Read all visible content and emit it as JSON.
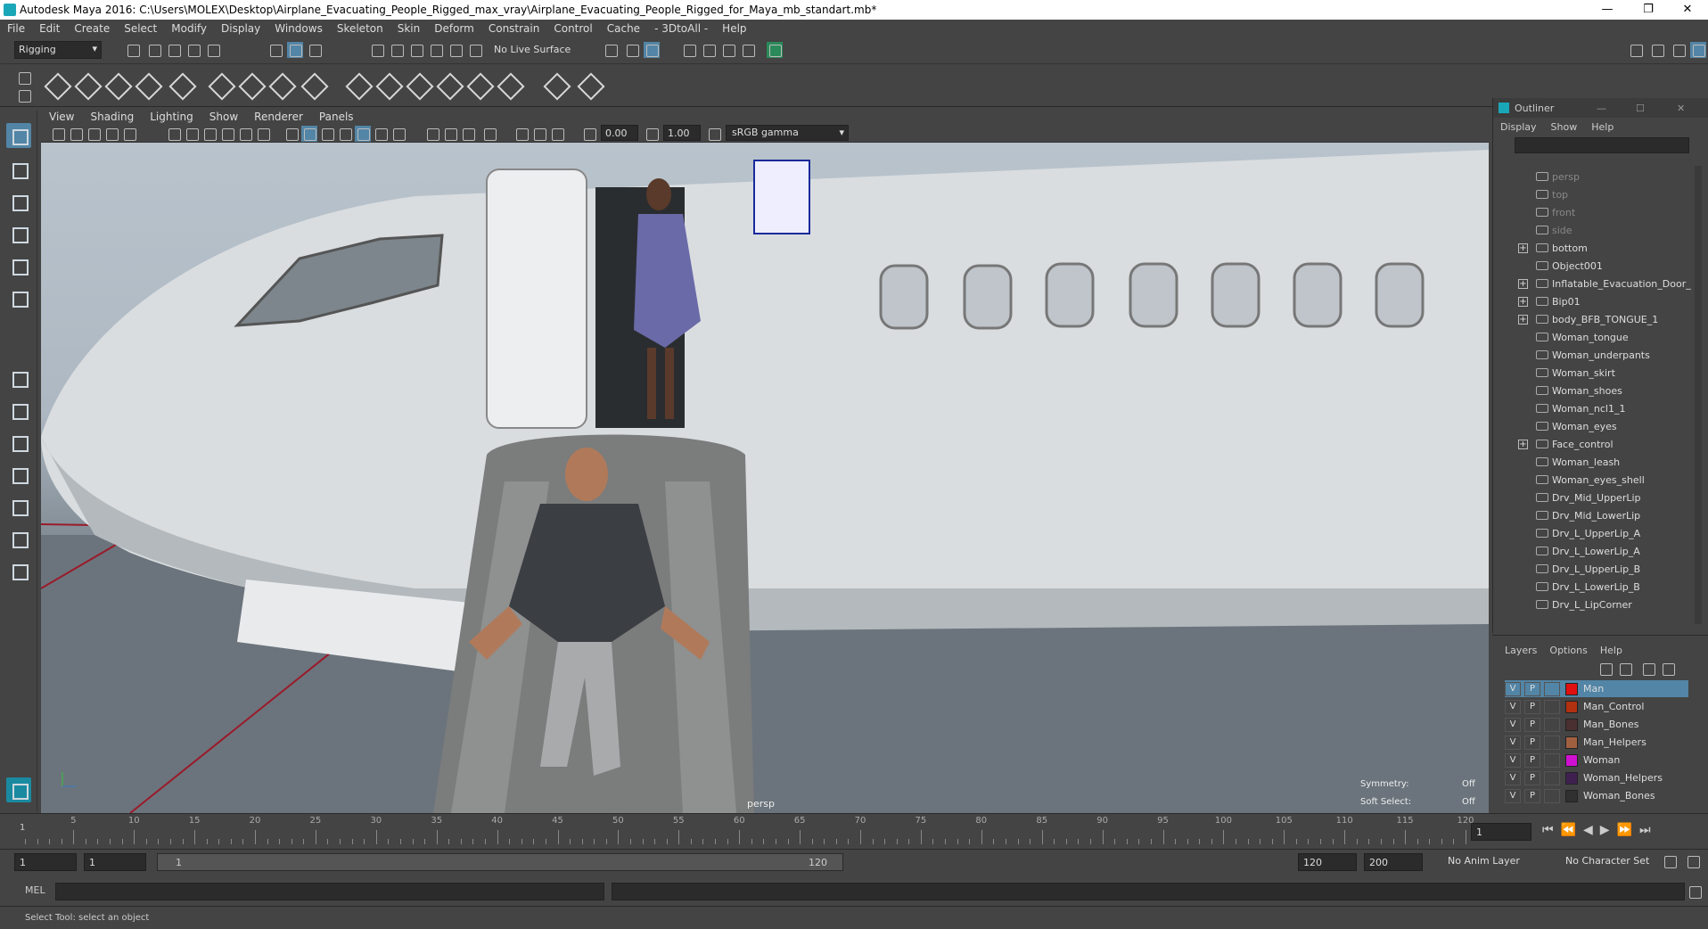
{
  "window": {
    "title": "Autodesk Maya 2016: C:\\Users\\MOLEX\\Desktop\\Airplane_Evacuating_People_Rigged_max_vray\\Airplane_Evacuating_People_Rigged_for_Maya_mb_standart.mb*",
    "controls": {
      "minimize": "—",
      "restore": "❐",
      "close": "✕"
    }
  },
  "menubar": [
    "File",
    "Edit",
    "Create",
    "Select",
    "Modify",
    "Display",
    "Windows",
    "Skeleton",
    "Skin",
    "Deform",
    "Constrain",
    "Control",
    "Cache",
    "- 3DtoAll -",
    "Help"
  ],
  "status_line": {
    "mode": "Rigging",
    "live_surface": "No Live Surface"
  },
  "viewport": {
    "menu": [
      "View",
      "Shading",
      "Lighting",
      "Show",
      "Renderer",
      "Panels"
    ],
    "exposure": "0.00",
    "gamma": "1.00",
    "color_space": "sRGB gamma",
    "camera_label": "persp",
    "symmetry_label": "Symmetry:",
    "symmetry_value": "Off",
    "soft_select_label": "Soft Select:",
    "soft_select_value": "Off"
  },
  "outliner": {
    "title": "Outliner",
    "menu": [
      "Display",
      "Show",
      "Help"
    ],
    "items": [
      {
        "label": "persp",
        "dim": true,
        "expand": false,
        "icon": "camera-icon"
      },
      {
        "label": "top",
        "dim": true,
        "expand": false,
        "icon": "camera-icon"
      },
      {
        "label": "front",
        "dim": true,
        "expand": false,
        "icon": "camera-icon"
      },
      {
        "label": "side",
        "dim": true,
        "expand": false,
        "icon": "camera-icon"
      },
      {
        "label": "bottom",
        "dim": false,
        "expand": true,
        "icon": "camera-icon"
      },
      {
        "label": "Object001",
        "dim": false,
        "expand": false,
        "icon": "mesh-icon"
      },
      {
        "label": "Inflatable_Evacuation_Door_S",
        "dim": false,
        "expand": true,
        "icon": "joint-icon"
      },
      {
        "label": "Bip01",
        "dim": false,
        "expand": true,
        "icon": "joint-icon"
      },
      {
        "label": "body_BFB_TONGUE_1",
        "dim": false,
        "expand": true,
        "icon": "joint-icon"
      },
      {
        "label": "Woman_tongue",
        "dim": false,
        "expand": false,
        "icon": "mesh-icon"
      },
      {
        "label": "Woman_underpants",
        "dim": false,
        "expand": false,
        "icon": "mesh-icon"
      },
      {
        "label": "Woman_skirt",
        "dim": false,
        "expand": false,
        "icon": "mesh-icon"
      },
      {
        "label": "Woman_shoes",
        "dim": false,
        "expand": false,
        "icon": "mesh-icon"
      },
      {
        "label": "Woman_ncl1_1",
        "dim": false,
        "expand": false,
        "icon": "mesh-icon"
      },
      {
        "label": "Woman_eyes",
        "dim": false,
        "expand": false,
        "icon": "mesh-icon"
      },
      {
        "label": "Face_control",
        "dim": false,
        "expand": true,
        "icon": "mesh-icon"
      },
      {
        "label": "Woman_leash",
        "dim": false,
        "expand": false,
        "icon": "mesh-icon"
      },
      {
        "label": "Woman_eyes_shell",
        "dim": false,
        "expand": false,
        "icon": "mesh-icon"
      },
      {
        "label": "Drv_Mid_UpperLip",
        "dim": false,
        "expand": false,
        "icon": "mesh-icon"
      },
      {
        "label": "Drv_Mid_LowerLip",
        "dim": false,
        "expand": false,
        "icon": "mesh-icon"
      },
      {
        "label": "Drv_L_UpperLip_A",
        "dim": false,
        "expand": false,
        "icon": "mesh-icon"
      },
      {
        "label": "Drv_L_LowerLip_A",
        "dim": false,
        "expand": false,
        "icon": "mesh-icon"
      },
      {
        "label": "Drv_L_UpperLip_B",
        "dim": false,
        "expand": false,
        "icon": "mesh-icon"
      },
      {
        "label": "Drv_L_LowerLip_B",
        "dim": false,
        "expand": false,
        "icon": "mesh-icon"
      },
      {
        "label": "Drv_L_LipCorner",
        "dim": false,
        "expand": false,
        "icon": "mesh-icon"
      }
    ]
  },
  "layers": {
    "menu": [
      "Layers",
      "Options",
      "Help"
    ],
    "rows": [
      {
        "v": "V",
        "p": "P",
        "color": "#e01010",
        "name": "Man",
        "selected": true
      },
      {
        "v": "V",
        "p": "P",
        "color": "#b03010",
        "name": "Man_Control",
        "selected": false
      },
      {
        "v": "V",
        "p": "P",
        "color": "#4a3030",
        "name": "Man_Bones",
        "selected": false
      },
      {
        "v": "V",
        "p": "P",
        "color": "#a06040",
        "name": "Man_Helpers",
        "selected": false
      },
      {
        "v": "V",
        "p": "P",
        "color": "#d010d0",
        "name": "Woman",
        "selected": false
      },
      {
        "v": "V",
        "p": "P",
        "color": "#402050",
        "name": "Woman_Helpers",
        "selected": false
      },
      {
        "v": "V",
        "p": "P",
        "color": "#303030",
        "name": "Woman_Bones",
        "selected": false
      }
    ]
  },
  "timeline": {
    "ticks": [
      "5",
      "10",
      "15",
      "20",
      "25",
      "30",
      "35",
      "40",
      "45",
      "50",
      "55",
      "60",
      "65",
      "70",
      "75",
      "80",
      "85",
      "90",
      "95",
      "100",
      "105",
      "110",
      "115",
      "120"
    ],
    "start_label": "1",
    "current_frame": "1"
  },
  "range": {
    "start": "1",
    "playback_start": "1",
    "range_start_label": "1",
    "range_end_label": "120",
    "playback_end": "120",
    "end": "200",
    "anim_layer": "No Anim Layer",
    "character_set": "No Character Set"
  },
  "command_line": {
    "label": "MEL"
  },
  "help_line": {
    "text": "Select Tool: select an object"
  },
  "colors": {
    "accent": "#1aa8b8",
    "selection": "#5285a6",
    "panel_bg": "#444444",
    "field_bg": "#2b2b2b"
  }
}
